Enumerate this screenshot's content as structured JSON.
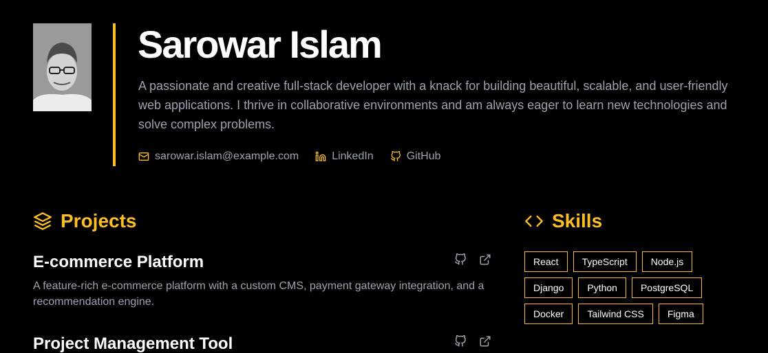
{
  "header": {
    "name": "Sarowar Islam",
    "bio": "A passionate and creative full-stack developer with a knack for building beautiful, scalable, and user-friendly web applications. I thrive in collaborative environments and am always eager to learn new technologies and solve complex problems.",
    "contacts": [
      {
        "icon": "mail-icon",
        "label": "sarowar.islam@example.com"
      },
      {
        "icon": "linkedin-icon",
        "label": "LinkedIn"
      },
      {
        "icon": "github-icon",
        "label": "GitHub"
      }
    ]
  },
  "projects": {
    "title": "Projects",
    "items": [
      {
        "title": "E-commerce Platform",
        "description": "A feature-rich e-commerce platform with a custom CMS, payment gateway integration, and a recommendation engine."
      },
      {
        "title": "Project Management Tool",
        "description": ""
      }
    ]
  },
  "skills": {
    "title": "Skills",
    "items": [
      "React",
      "TypeScript",
      "Node.js",
      "Django",
      "Python",
      "PostgreSQL",
      "Docker",
      "Tailwind CSS",
      "Figma"
    ]
  },
  "colors": {
    "accent": "#fbbf24",
    "background": "#000000",
    "muted_text": "#9ca3af",
    "heading_text": "#ffffff"
  }
}
